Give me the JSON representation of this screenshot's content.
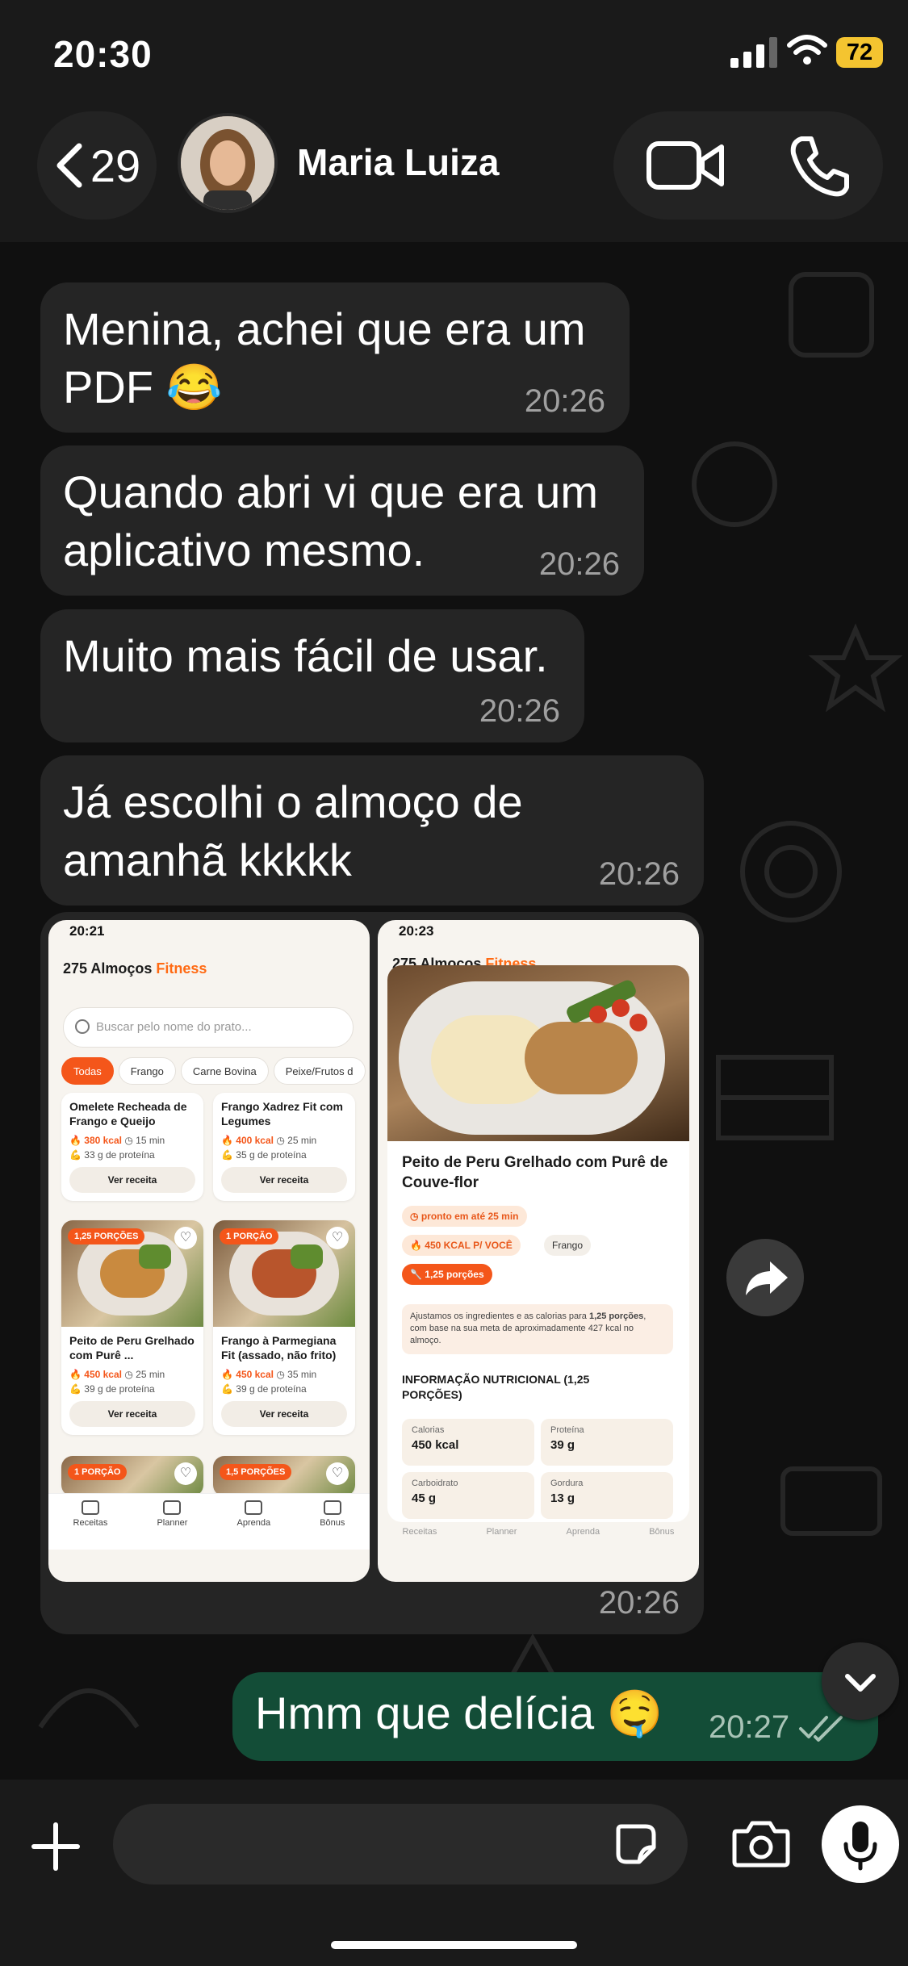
{
  "status_bar": {
    "time": "20:30",
    "battery": "72"
  },
  "header": {
    "back_count": "29",
    "contact_name": "Maria Luiza"
  },
  "messages": [
    {
      "text": "Menina, achei que era um PDF 😂",
      "time": "20:26"
    },
    {
      "text": "Quando abri vi que era um aplicativo mesmo.",
      "time": "20:26"
    },
    {
      "text": "Muito mais fácil de usar.",
      "time": "20:26"
    },
    {
      "text": "Já escolhi o almoço de amanhã kkkkk",
      "time": "20:26"
    }
  ],
  "image_message": {
    "time": "20:26",
    "left_screen": {
      "time": "20:21",
      "title_main": "275 Almoços",
      "title_accent": "Fitness",
      "search_placeholder": "Buscar pelo nome do prato...",
      "chips": [
        "Todas",
        "Frango",
        "Carne Bovina",
        "Peixe/Frutos d"
      ],
      "cards": [
        {
          "title": "Omelete Recheada de Frango e Queijo",
          "kcal": "380 kcal",
          "time": "15 min",
          "protein": "33 g de proteína",
          "button": "Ver receita",
          "badge": ""
        },
        {
          "title": "Frango Xadrez Fit com Legumes",
          "kcal": "400 kcal",
          "time": "25 min",
          "protein": "35 g de proteína",
          "button": "Ver receita",
          "badge": ""
        },
        {
          "title": "Peito de Peru Grelhado com Purê ...",
          "kcal": "450 kcal",
          "time": "25 min",
          "protein": "39 g de proteína",
          "button": "Ver receita",
          "badge": "1,25 PORÇÕES"
        },
        {
          "title": "Frango à Parmegiana Fit (assado, não frito)",
          "kcal": "450 kcal",
          "time": "35 min",
          "protein": "39 g de proteína",
          "button": "Ver receita",
          "badge": "1 PORÇÃO"
        },
        {
          "badge": "1 PORÇÃO"
        },
        {
          "badge": "1,5 PORÇÕES"
        }
      ],
      "tabs": [
        "Receitas",
        "Planner",
        "Aprenda",
        "Bônus"
      ]
    },
    "right_screen": {
      "time": "20:23",
      "title_main": "275 Almoços",
      "title_accent": "Fitness",
      "recipe_title": "Peito de Peru Grelhado com Purê de Couve-flor",
      "ready_in": "pronto em até 25 min",
      "kcal_per": "450 KCAL P/ VOCÊ",
      "category": "Frango",
      "portions": "1,25 porções",
      "note_pre": "Ajustamos os ingredientes e as calorias para ",
      "note_bold1": "1,25 porções",
      "note_post": ", com base na sua meta de aproximadamente 427 kcal no almoço.",
      "nutrition_title": "INFORMAÇÃO NUTRICIONAL (1,25 PORÇÕES)",
      "nutrition": [
        {
          "label": "Calorias",
          "value": "450 kcal"
        },
        {
          "label": "Proteína",
          "value": "39 g"
        },
        {
          "label": "Carboidrato",
          "value": "45 g"
        },
        {
          "label": "Gordura",
          "value": "13 g"
        }
      ],
      "tabs": [
        "Receitas",
        "Planner",
        "Aprenda",
        "Bônus"
      ]
    }
  },
  "outgoing": {
    "text": "Hmm que delícia 🤤",
    "time": "20:27"
  },
  "input": {
    "placeholder": ""
  },
  "icons": [
    "back-chevron-icon",
    "video-call-icon",
    "phone-icon",
    "forward-icon",
    "chevron-down-icon",
    "plus-icon",
    "sticker-icon",
    "camera-icon",
    "mic-icon",
    "double-check-icon"
  ]
}
